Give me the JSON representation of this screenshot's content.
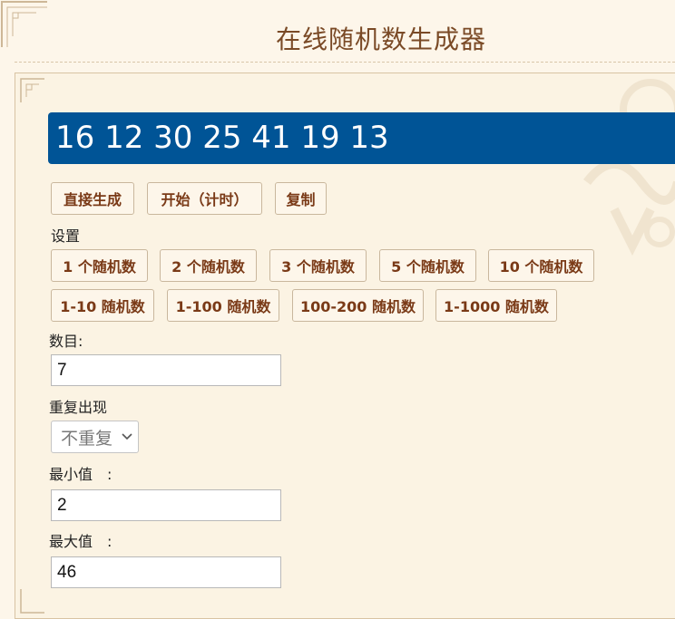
{
  "header": {
    "title": "在线随机数生成器"
  },
  "result": {
    "numbers": "16 12 30 25 41 19 13"
  },
  "actions": {
    "generate_label": "直接生成",
    "start_timer_label": "开始（计时）",
    "copy_label": "复制"
  },
  "settings": {
    "heading": "设置",
    "presets_row1": [
      "1 个随机数",
      "2 个随机数",
      "3 个随机数",
      "5 个随机数",
      "10 个随机数"
    ],
    "presets_row2": [
      "1-10 随机数",
      "1-100 随机数",
      "100-200 随机数",
      "1-1000 随机数"
    ]
  },
  "form": {
    "count_label": "数目:",
    "count_value": "7",
    "repeat_label": "重复出现",
    "repeat_selected": "不重复",
    "min_label": "最小值　:",
    "min_value": "2",
    "max_label": "最大值　:",
    "max_value": "46"
  },
  "colors": {
    "result_bg": "#005496",
    "button_text": "#7a3a17",
    "title_text": "#7a4a26",
    "page_bg": "#fdf6ea"
  }
}
